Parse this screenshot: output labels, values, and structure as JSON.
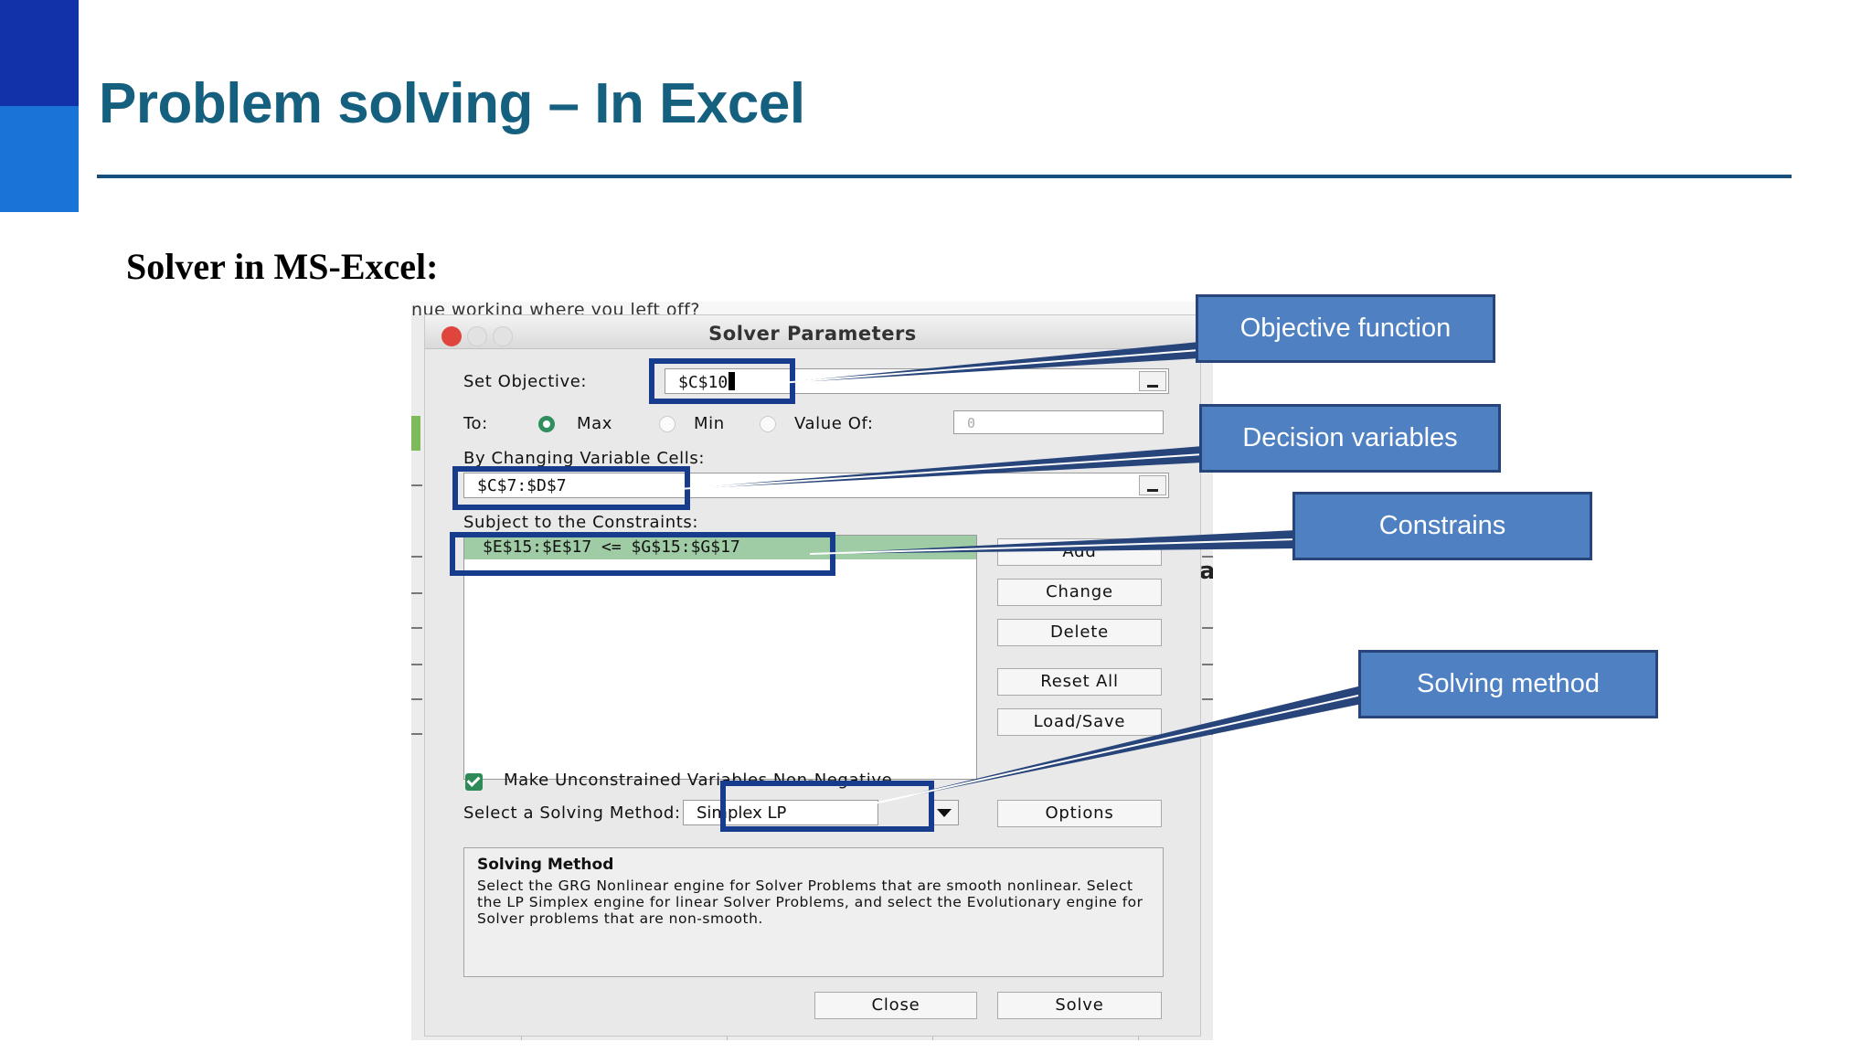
{
  "slide": {
    "title": "Problem solving – In Excel",
    "subtitle": "Solver in MS-Excel:"
  },
  "background": {
    "partial_text": "nue working where you left off?",
    "right_letter": "a"
  },
  "dialog": {
    "title": "Solver Parameters",
    "set_objective_label": "Set Objective:",
    "set_objective_value": "$C$10",
    "to_label": "To:",
    "radio_max": "Max",
    "radio_min": "Min",
    "radio_value_of": "Value Of:",
    "value_of_value": "0",
    "by_changing_label": "By Changing Variable Cells:",
    "by_changing_value": "$C$7:$D$7",
    "subject_to_label": "Subject to the Constraints:",
    "constraint_1": "$E$15:$E$17 <= $G$15:$G$17",
    "btn_add": "Add",
    "btn_change": "Change",
    "btn_delete": "Delete",
    "btn_reset_all": "Reset All",
    "btn_load_save": "Load/Save",
    "nonneg_label": "Make Unconstrained Variables Non-Negative",
    "method_label": "Select a Solving Method:",
    "method_value": "Simplex LP",
    "btn_options": "Options",
    "method_box_title": "Solving Method",
    "method_box_text": "Select the GRG Nonlinear engine for Solver Problems that are smooth nonlinear. Select the LP Simplex engine for linear Solver Problems, and select the Evolutionary engine for Solver problems that are non-smooth.",
    "btn_close": "Close",
    "btn_solve": "Solve"
  },
  "callouts": {
    "objective": "Objective function",
    "decision": "Decision variables",
    "constraints": "Constrains",
    "method": "Solving method"
  },
  "colors": {
    "title": "#15607f",
    "rule": "#164f7c",
    "accent_dark": "#1132a8",
    "accent_light": "#1a73d6",
    "callout_fill": "#4f81c2",
    "highlight_border": "#173c8d",
    "constraint_row": "#9fcca5"
  }
}
